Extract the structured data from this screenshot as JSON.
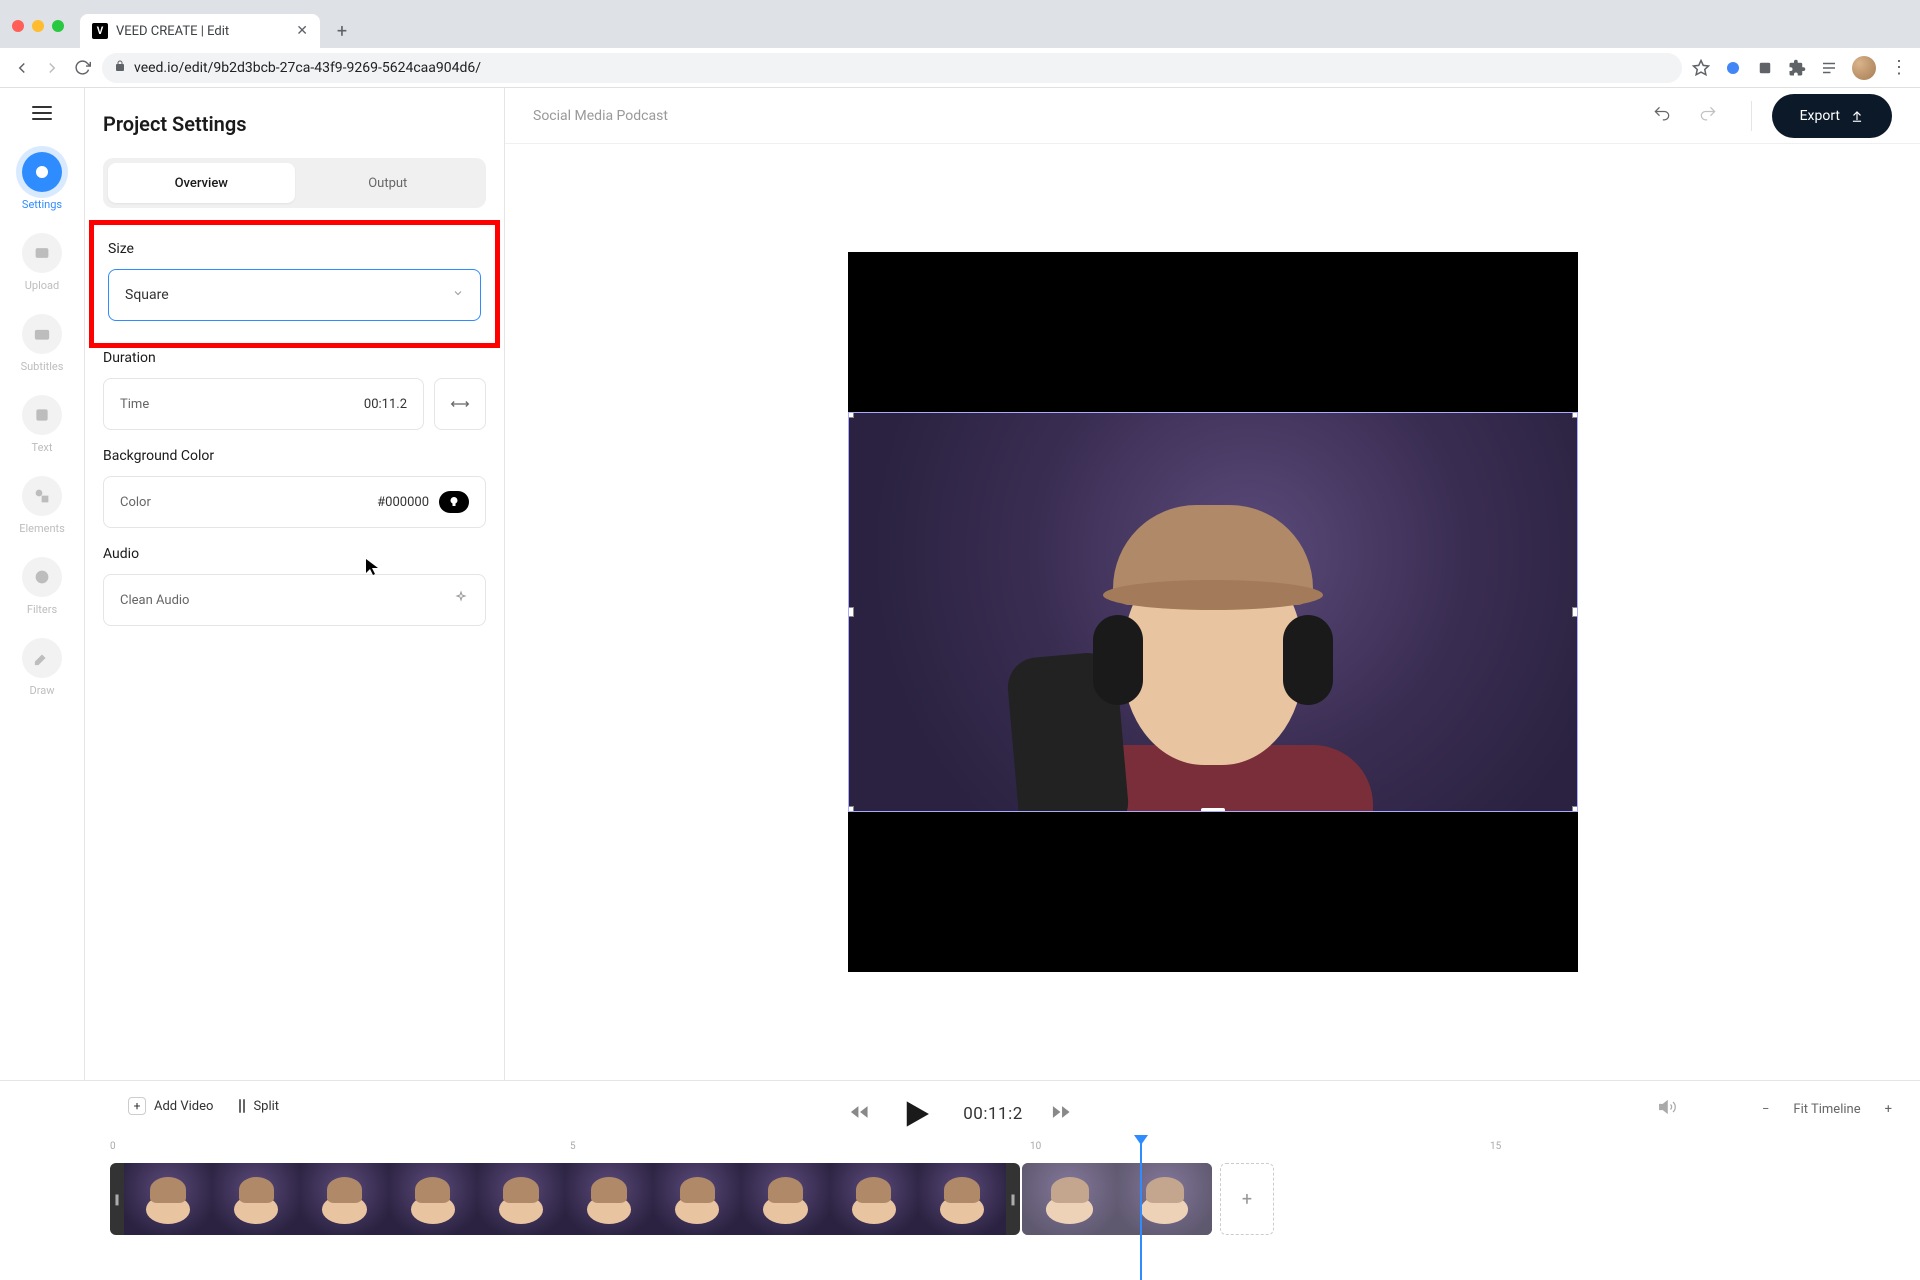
{
  "browser": {
    "tab_title": "VEED CREATE | Edit",
    "url": "veed.io/edit/9b2d3bcb-27ca-43f9-9269-5624caa904d6/"
  },
  "sidebar": {
    "items": [
      {
        "label": "Settings",
        "icon": "settings"
      },
      {
        "label": "Upload",
        "icon": "upload"
      },
      {
        "label": "Subtitles",
        "icon": "subtitles"
      },
      {
        "label": "Text",
        "icon": "text"
      },
      {
        "label": "Elements",
        "icon": "elements"
      },
      {
        "label": "Filters",
        "icon": "filters"
      },
      {
        "label": "Draw",
        "icon": "draw"
      }
    ]
  },
  "panel": {
    "title": "Project Settings",
    "tabs": {
      "overview": "Overview",
      "output": "Output"
    },
    "size": {
      "label": "Size",
      "value": "Square"
    },
    "duration": {
      "label": "Duration",
      "time_label": "Time",
      "time_value": "00:11.2"
    },
    "bg": {
      "label": "Background Color",
      "color_label": "Color",
      "color_value": "#000000"
    },
    "audio": {
      "label": "Audio",
      "clean_label": "Clean Audio"
    }
  },
  "header": {
    "project_name": "Social Media Podcast",
    "export_label": "Export"
  },
  "timeline": {
    "add_video": "Add Video",
    "split": "Split",
    "current_time": "00:11:2",
    "fit": "Fit Timeline",
    "ruler": [
      "0",
      "5",
      "10",
      "15"
    ]
  }
}
